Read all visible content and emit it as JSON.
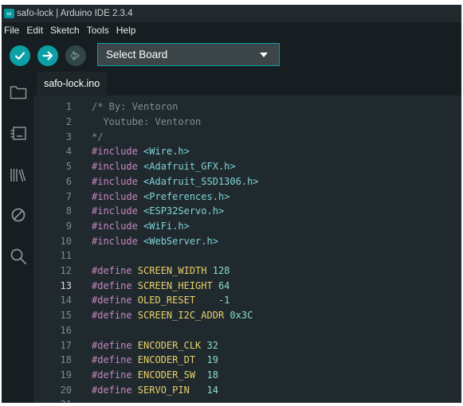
{
  "window": {
    "title": "safo-lock | Arduino IDE 2.3.4"
  },
  "menu": [
    "File",
    "Edit",
    "Sketch",
    "Tools",
    "Help"
  ],
  "toolbar": {
    "board_select_label": "Select Board"
  },
  "tab": {
    "label": "safo-lock.ino"
  },
  "editor": {
    "active_line": 13,
    "lines": [
      {
        "n": "1",
        "tokens": [
          {
            "t": "/* By: Ventoron",
            "c": "comment"
          }
        ]
      },
      {
        "n": "2",
        "tokens": [
          {
            "t": "  Youtube: Ventoron",
            "c": "comment"
          }
        ]
      },
      {
        "n": "3",
        "tokens": [
          {
            "t": "*/",
            "c": "comment"
          }
        ]
      },
      {
        "n": "4",
        "tokens": [
          {
            "t": "#include ",
            "c": "kw"
          },
          {
            "t": "<Wire.h>",
            "c": "inc"
          }
        ]
      },
      {
        "n": "5",
        "tokens": [
          {
            "t": "#include ",
            "c": "kw"
          },
          {
            "t": "<Adafruit_GFX.h>",
            "c": "inc"
          }
        ]
      },
      {
        "n": "6",
        "tokens": [
          {
            "t": "#include ",
            "c": "kw"
          },
          {
            "t": "<Adafruit_SSD1306.h>",
            "c": "inc"
          }
        ]
      },
      {
        "n": "7",
        "tokens": [
          {
            "t": "#include ",
            "c": "kw"
          },
          {
            "t": "<Preferences.h>",
            "c": "inc"
          }
        ]
      },
      {
        "n": "8",
        "tokens": [
          {
            "t": "#include ",
            "c": "kw"
          },
          {
            "t": "<ESP32Servo.h>",
            "c": "inc"
          }
        ]
      },
      {
        "n": "9",
        "tokens": [
          {
            "t": "#include ",
            "c": "kw"
          },
          {
            "t": "<WiFi.h>",
            "c": "inc"
          }
        ]
      },
      {
        "n": "10",
        "tokens": [
          {
            "t": "#include ",
            "c": "kw"
          },
          {
            "t": "<WebServer.h>",
            "c": "inc"
          }
        ]
      },
      {
        "n": "11",
        "tokens": []
      },
      {
        "n": "12",
        "tokens": [
          {
            "t": "#define ",
            "c": "kw"
          },
          {
            "t": "SCREEN_WIDTH",
            "c": "macro"
          },
          {
            "t": " ",
            "c": "plain"
          },
          {
            "t": "128",
            "c": "num"
          }
        ]
      },
      {
        "n": "13",
        "tokens": [
          {
            "t": "#define ",
            "c": "kw"
          },
          {
            "t": "SCREEN_HEIGHT",
            "c": "macro"
          },
          {
            "t": " ",
            "c": "plain"
          },
          {
            "t": "64",
            "c": "num"
          }
        ]
      },
      {
        "n": "14",
        "tokens": [
          {
            "t": "#define ",
            "c": "kw"
          },
          {
            "t": "OLED_RESET",
            "c": "macro"
          },
          {
            "t": "    ",
            "c": "plain"
          },
          {
            "t": "-1",
            "c": "num"
          }
        ]
      },
      {
        "n": "15",
        "tokens": [
          {
            "t": "#define ",
            "c": "kw"
          },
          {
            "t": "SCREEN_I2C_ADDR",
            "c": "macro"
          },
          {
            "t": " ",
            "c": "plain"
          },
          {
            "t": "0x3C",
            "c": "num"
          }
        ]
      },
      {
        "n": "16",
        "tokens": []
      },
      {
        "n": "17",
        "tokens": [
          {
            "t": "#define ",
            "c": "kw"
          },
          {
            "t": "ENCODER_CLK",
            "c": "macro"
          },
          {
            "t": " ",
            "c": "plain"
          },
          {
            "t": "32",
            "c": "num"
          }
        ]
      },
      {
        "n": "18",
        "tokens": [
          {
            "t": "#define ",
            "c": "kw"
          },
          {
            "t": "ENCODER_DT",
            "c": "macro"
          },
          {
            "t": "  ",
            "c": "plain"
          },
          {
            "t": "19",
            "c": "num"
          }
        ]
      },
      {
        "n": "19",
        "tokens": [
          {
            "t": "#define ",
            "c": "kw"
          },
          {
            "t": "ENCODER_SW",
            "c": "macro"
          },
          {
            "t": "  ",
            "c": "plain"
          },
          {
            "t": "18",
            "c": "num"
          }
        ]
      },
      {
        "n": "20",
        "tokens": [
          {
            "t": "#define ",
            "c": "kw"
          },
          {
            "t": "SERVO_PIN",
            "c": "macro"
          },
          {
            "t": "   ",
            "c": "plain"
          },
          {
            "t": "14",
            "c": "num"
          }
        ]
      },
      {
        "n": "21",
        "tokens": []
      }
    ]
  },
  "icons": {
    "verify": "checkmark-icon",
    "upload": "arrow-right-icon",
    "debug": "debug-icon",
    "board_caret": "caret-down-icon",
    "activity": [
      "folder-icon",
      "board-manager-icon",
      "library-icon",
      "debug-disabled-icon",
      "search-icon"
    ]
  },
  "colors": {
    "accent": "#0aa0a5",
    "background": "#171e21",
    "editor_background": "#202a2e",
    "keyword": "#c586c0",
    "include_path": "#7fd3d8",
    "macro": "#e8cf6b",
    "number": "#8bdcc2",
    "comment": "#7b8f95"
  }
}
